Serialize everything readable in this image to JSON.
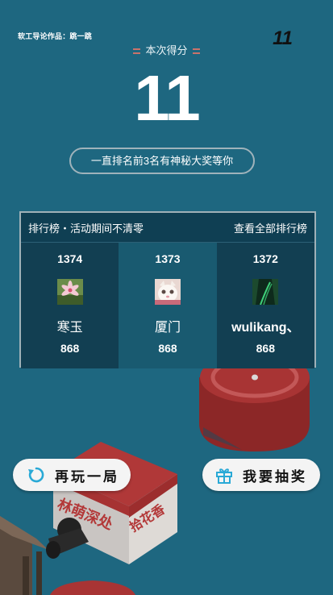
{
  "credit": "软工导论作品：跳一跳",
  "corner_score": "11",
  "score_label": "本次得分",
  "score": "11",
  "hint": "一直排名前3名有神秘大奖等你",
  "leaderboard": {
    "title": "排行榜・活动期间不清零",
    "view_all": "查看全部排行榜",
    "entries": [
      {
        "rank_score": "1374",
        "name": "寒玉",
        "score": "868",
        "avatar": "flower-avatar"
      },
      {
        "rank_score": "1373",
        "name": "厦门",
        "score": "868",
        "avatar": "cat-avatar"
      },
      {
        "rank_score": "1372",
        "name": "wulikang、",
        "score": "868",
        "avatar": "forest-avatar"
      }
    ]
  },
  "buttons": {
    "replay": "再玩一局",
    "draw": "我要抽奖"
  },
  "scene": {
    "box_front_text": "林萌深处",
    "box_side_text": "拾花香"
  },
  "colors": {
    "background": "#1e6780",
    "platform_red": "#a33232",
    "icon_cyan": "#29a9d6"
  }
}
